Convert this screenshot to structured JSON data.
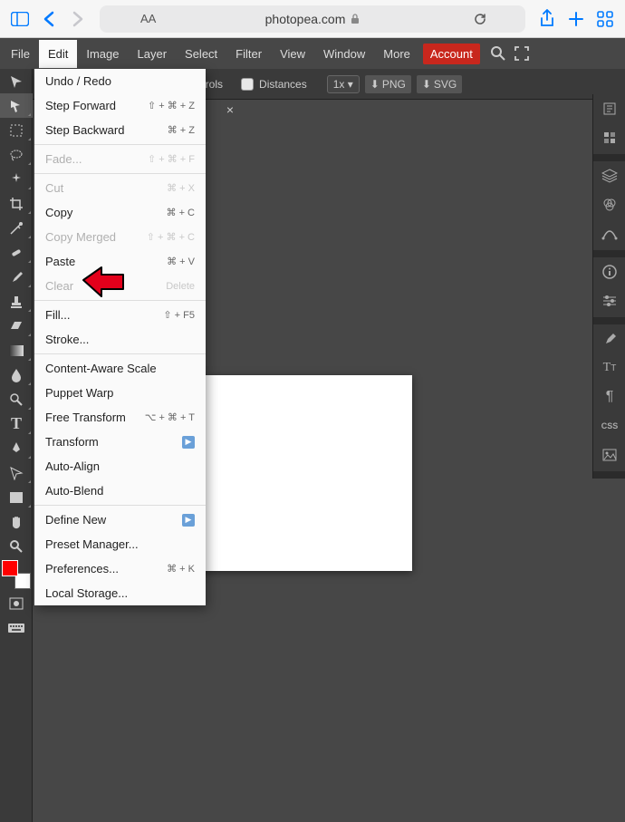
{
  "browser": {
    "url": "photopea.com"
  },
  "menubar": {
    "file": "File",
    "edit": "Edit",
    "image": "Image",
    "layer": "Layer",
    "select": "Select",
    "filter": "Filter",
    "view": "View",
    "window": "Window",
    "more": "More",
    "account": "Account"
  },
  "options": {
    "controls_partial": "ontrols",
    "distances": "Distances",
    "zoom": "1x",
    "png": "PNG",
    "svg": "SVG"
  },
  "edit_menu": [
    {
      "label": "Undo / Redo",
      "shortcut": ""
    },
    {
      "label": "Step Forward",
      "shortcut": "⇧ + ⌘ + Z"
    },
    {
      "label": "Step Backward",
      "shortcut": "⌘ + Z"
    },
    {
      "sep": true
    },
    {
      "label": "Fade...",
      "shortcut": "⇧ + ⌘ + F",
      "dim": true
    },
    {
      "sep": true
    },
    {
      "label": "Cut",
      "shortcut": "⌘ + X",
      "dim": true
    },
    {
      "label": "Copy",
      "shortcut": "⌘ + C"
    },
    {
      "label": "Copy Merged",
      "shortcut": "⇧ + ⌘ + C",
      "dim": true
    },
    {
      "label": "Paste",
      "shortcut": "⌘ + V"
    },
    {
      "label": "Clear",
      "shortcut": "Delete",
      "dim": true
    },
    {
      "sep": true
    },
    {
      "label": "Fill...",
      "shortcut": "⇧ + F5"
    },
    {
      "label": "Stroke...",
      "shortcut": ""
    },
    {
      "sep": true
    },
    {
      "label": "Content-Aware Scale",
      "shortcut": ""
    },
    {
      "label": "Puppet Warp",
      "shortcut": ""
    },
    {
      "label": "Free Transform",
      "shortcut": "⌥ + ⌘ + T"
    },
    {
      "label": "Transform",
      "shortcut": "",
      "submenu": true
    },
    {
      "label": "Auto-Align",
      "shortcut": ""
    },
    {
      "label": "Auto-Blend",
      "shortcut": ""
    },
    {
      "sep": true
    },
    {
      "label": "Define New",
      "shortcut": "",
      "submenu": true
    },
    {
      "label": "Preset Manager...",
      "shortcut": ""
    },
    {
      "label": "Preferences...",
      "shortcut": "⌘ + K"
    },
    {
      "label": "Local Storage...",
      "shortcut": ""
    }
  ],
  "right_panel": {
    "css": "CSS"
  }
}
